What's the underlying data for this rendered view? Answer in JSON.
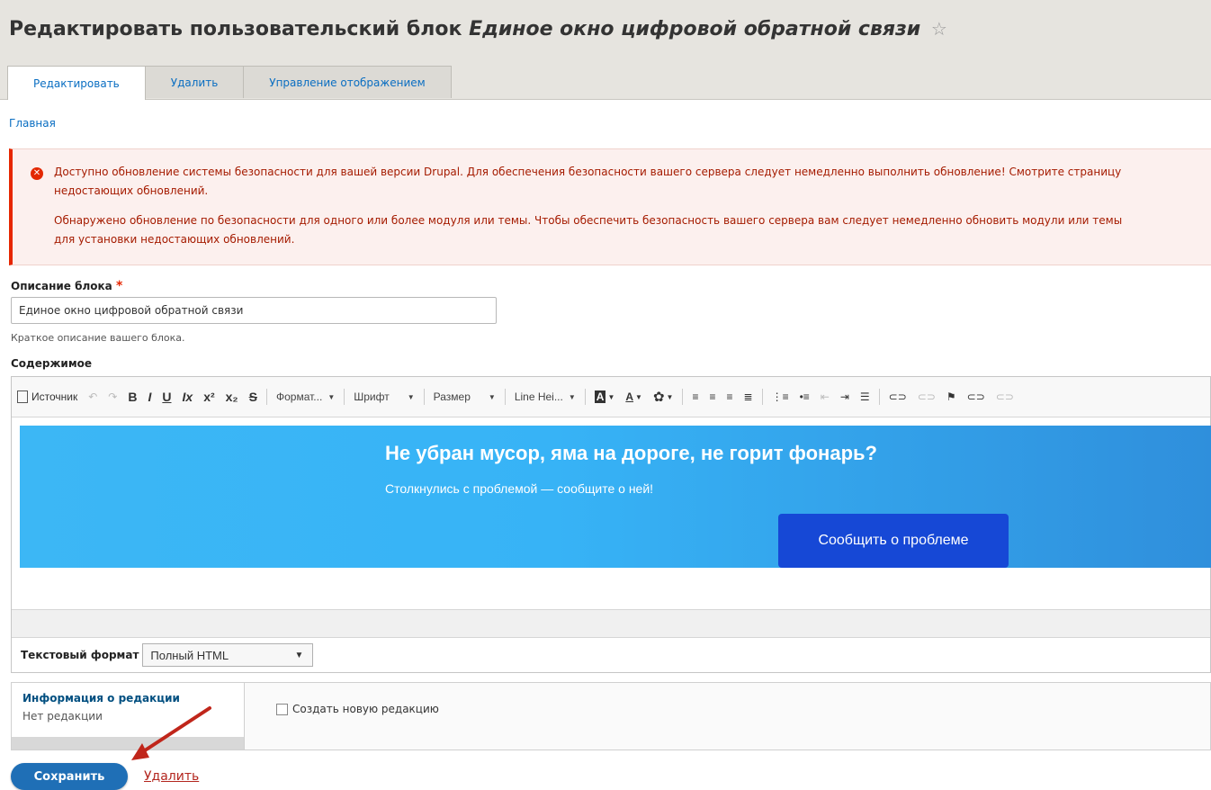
{
  "page": {
    "title_prefix": "Редактировать пользовательский блок",
    "title_block": "Единое окно цифровой обратной связи",
    "star_icon": "☆"
  },
  "tabs": [
    {
      "label": "Редактировать",
      "active": true
    },
    {
      "label": "Удалить",
      "active": false
    },
    {
      "label": "Управление отображением",
      "active": false
    }
  ],
  "breadcrumb": {
    "home": "Главная"
  },
  "alert": {
    "icon": "✕",
    "message1": "Доступно обновление системы безопасности для вашей версии Drupal. Для обеспечения безопасности вашего сервера следует немедленно выполнить обновление! Смотрите страницу\nнедостающих обновлений.",
    "message2": "Обнаружено обновление по безопасности для одного или более модуля или темы. Чтобы обеспечить безопасность вашего сервера вам следует немедленно обновить модули или темы\nдля установки недостающих обновлений."
  },
  "form": {
    "description_label": "Описание блока",
    "required_mark": "*",
    "description_value": "Единое окно цифровой обратной связи",
    "description_hint": "Краткое описание вашего блока.",
    "content_label": "Содержимое",
    "text_format_label": "Текстовый формат",
    "text_format_value": "Полный HTML"
  },
  "toolbar": {
    "source": "Источник",
    "undo": "↶",
    "redo": "↷",
    "bold": "B",
    "italic": "I",
    "underline": "U",
    "remove_format": "Ix",
    "superscript": "x²",
    "subscript": "x₂",
    "strike": "S",
    "format": "Формат...",
    "font": "Шрифт",
    "size": "Размер",
    "line_height": "Line Hei...",
    "bg_color": "A",
    "text_color": "A",
    "settings": "✿"
  },
  "banner": {
    "title": "Не убран мусор, яма на дороге, не горит фонарь?",
    "subtitle": "Столкнулись с проблемой — сообщите о ней!",
    "button": "Сообщить о проблеме"
  },
  "revision": {
    "title": "Информация о редакции",
    "status": "Нет редакции",
    "checkbox_label": "Создать новую редакцию"
  },
  "actions": {
    "save": "Сохранить",
    "delete": "Удалить"
  },
  "colors": {
    "accent": "#1f6fb6",
    "error": "#e62600",
    "banner_button": "#1648d6"
  }
}
